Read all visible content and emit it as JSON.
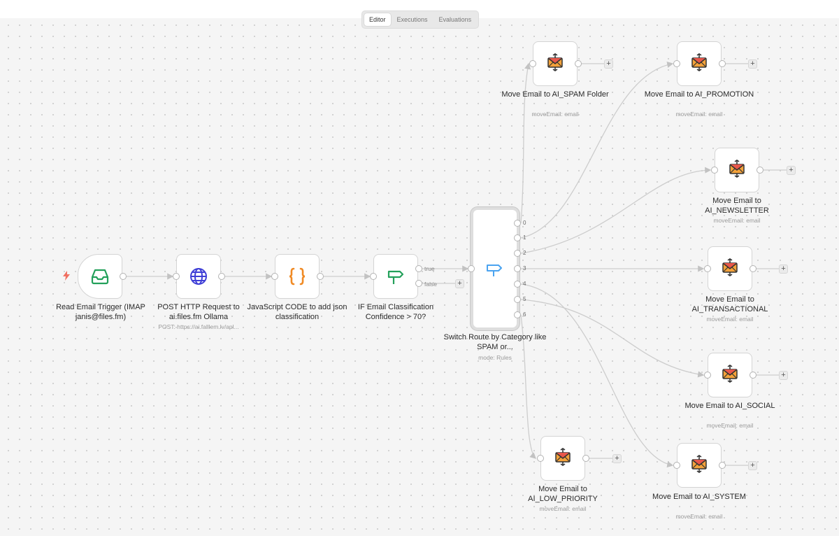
{
  "tabs": [
    {
      "label": "Editor",
      "active": true
    },
    {
      "label": "Executions",
      "active": false
    },
    {
      "label": "Evaluations",
      "active": false
    }
  ],
  "colors": {
    "trigger": "#23a05a",
    "http": "#3f3fd6",
    "code": "#f08a24",
    "if": "#23a05a",
    "switch": "#4aa3f0",
    "trigger_bolt": "#f07062"
  },
  "nodes": {
    "read_email": {
      "title": "Read Email Trigger (IMAP janis@files.fm)",
      "subtitle": "",
      "icon": "inbox-icon"
    },
    "post_http": {
      "title": "POST HTTP Request to ai.files.fm Ollama",
      "subtitle": "POST: https://ai.falllem.lv/apl...",
      "icon": "globe-icon"
    },
    "js_code": {
      "title": "JavaScript CODE to add json classification",
      "subtitle": "",
      "icon": "braces-icon"
    },
    "if_confidence": {
      "title": "IF Email Classification Confidence > 70?",
      "subtitle": "",
      "icon": "signpost-icon",
      "outputs": [
        "true",
        "false"
      ]
    },
    "switch_route": {
      "title": "Switch Route by Category like SPAM or...",
      "subtitle": "mode: Rules",
      "icon": "route-icon",
      "outputs": [
        "0",
        "1",
        "2",
        "3",
        "4",
        "5",
        "6"
      ]
    },
    "move_spam": {
      "title": "Move Email to AI_SPAM Folder",
      "subtitle": "moveEmail: email",
      "icon": "email-move-icon"
    },
    "move_promotion": {
      "title": "Move Email to AI_PROMOTION",
      "subtitle": "moveEmail: email",
      "icon": "email-move-icon"
    },
    "move_newsletter": {
      "title": "Move Email to AI_NEWSLETTER",
      "subtitle": "moveEmail: email",
      "icon": "email-move-icon"
    },
    "move_transactional": {
      "title": "Move Email to AI_TRANSACTIONAL",
      "subtitle": "moveEmail: email",
      "icon": "email-move-icon"
    },
    "move_social": {
      "title": "Move Email to AI_SOCIAL",
      "subtitle": "moveEmail: email",
      "icon": "email-move-icon"
    },
    "move_low_priority": {
      "title": "Move Email to AI_LOW_PRIORITY",
      "subtitle": "moveEmail: email",
      "icon": "email-move-icon"
    },
    "move_system": {
      "title": "Move Email to AI_SYSTEM",
      "subtitle": "moveEmail: email",
      "icon": "email-move-icon"
    }
  }
}
